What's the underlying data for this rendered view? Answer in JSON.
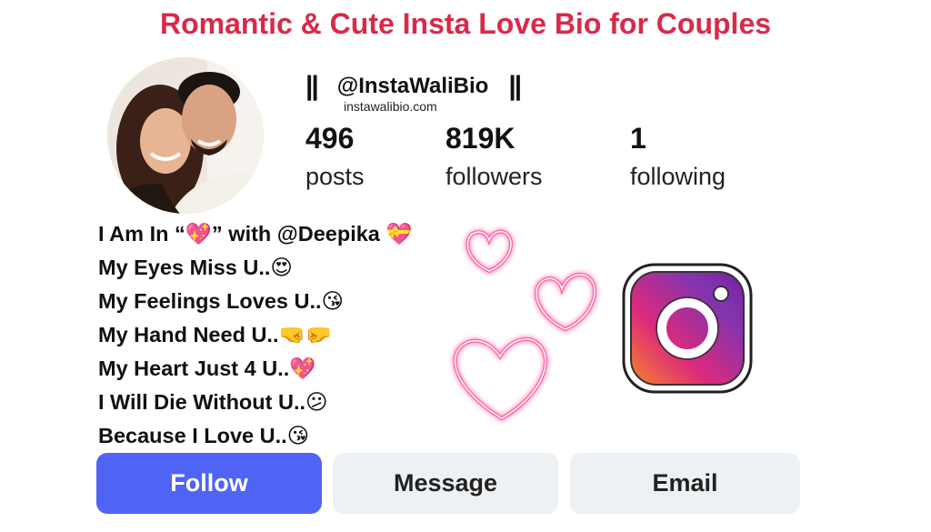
{
  "title": "Romantic & Cute Insta Love Bio for Couples",
  "profile": {
    "bars_left": "||",
    "handle": "@InstaWaliBio",
    "bars_right": "||",
    "website": "instawalibio.com",
    "stats": [
      {
        "value": "496",
        "label": "posts"
      },
      {
        "value": "819K",
        "label": "followers"
      },
      {
        "value": "1",
        "label": "following"
      }
    ]
  },
  "bio": [
    {
      "pre": "I Am In “",
      "emoji": "💖",
      "post": "” with @Deepika ",
      "emoji2": "💝"
    },
    {
      "pre": "My Eyes Miss U..",
      "emoji": "😍",
      "post": "",
      "emoji2": ""
    },
    {
      "pre": "My Feelings Loves U..",
      "emoji": "😘",
      "post": "",
      "emoji2": ""
    },
    {
      "pre": "My Hand Need U..",
      "emoji": "🤜🤛",
      "post": "",
      "emoji2": ""
    },
    {
      "pre": "My Heart Just 4 U..",
      "emoji": "💖",
      "post": "",
      "emoji2": ""
    },
    {
      "pre": "I Will Die Without U..",
      "emoji": "😕",
      "post": "",
      "emoji2": ""
    },
    {
      "pre": "Because I Love U..",
      "emoji": "😘",
      "post": "",
      "emoji2": ""
    }
  ],
  "buttons": {
    "follow": "Follow",
    "message": "Message",
    "email": "Email"
  },
  "colors": {
    "title": "#d72a4a",
    "follow_button": "#4f63f5",
    "secondary_button": "#eef1f4",
    "neon_heart": "#ff5fa2"
  },
  "icons": [
    "avatar-photo",
    "neon-heart-icon",
    "instagram-logo-icon"
  ]
}
